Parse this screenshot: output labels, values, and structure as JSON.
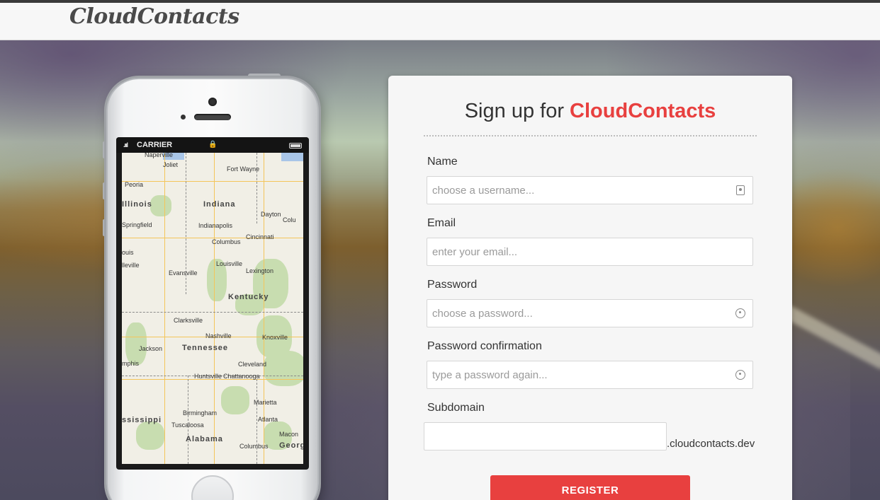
{
  "header": {
    "brand": "CloudContacts"
  },
  "phone": {
    "status": {
      "signal": ".ııl",
      "carrier": "CARRIER",
      "lock": "🔒"
    },
    "map": {
      "cities": [
        "Naperville",
        "Joliet",
        "Fort Wayne",
        "Peoria",
        "Indiana",
        "Dayton",
        "Colu",
        "Springfield",
        "Indianapolis",
        "Cincinnati",
        "Columbus",
        "ouis",
        "Louisville",
        "Lexington",
        "lleville",
        "Evansville",
        "Kentucky",
        "Clarksville",
        "Nashville",
        "Knoxville",
        "Jackson",
        "Tennessee",
        "mphis",
        "Cleveland",
        "Huntsville",
        "Chattanooga",
        "Marietta",
        "Birmingham",
        "Atlanta",
        "ssissippi",
        "Tuscaloosa",
        "Macon",
        "Alabama",
        "Columbus",
        "Georg",
        "Illinois"
      ]
    }
  },
  "form": {
    "title_prefix": "Sign up for",
    "title_brand": "CloudContacts",
    "fields": {
      "name": {
        "label": "Name",
        "placeholder": "choose a username..."
      },
      "email": {
        "label": "Email",
        "placeholder": "enter your email..."
      },
      "password": {
        "label": "Password",
        "placeholder": "choose a password..."
      },
      "password_confirmation": {
        "label": "Password confirmation",
        "placeholder": "type a password again..."
      },
      "subdomain": {
        "label": "Subdomain",
        "suffix": ".cloudcontacts.dev"
      }
    },
    "submit_label": "REGISTER"
  }
}
